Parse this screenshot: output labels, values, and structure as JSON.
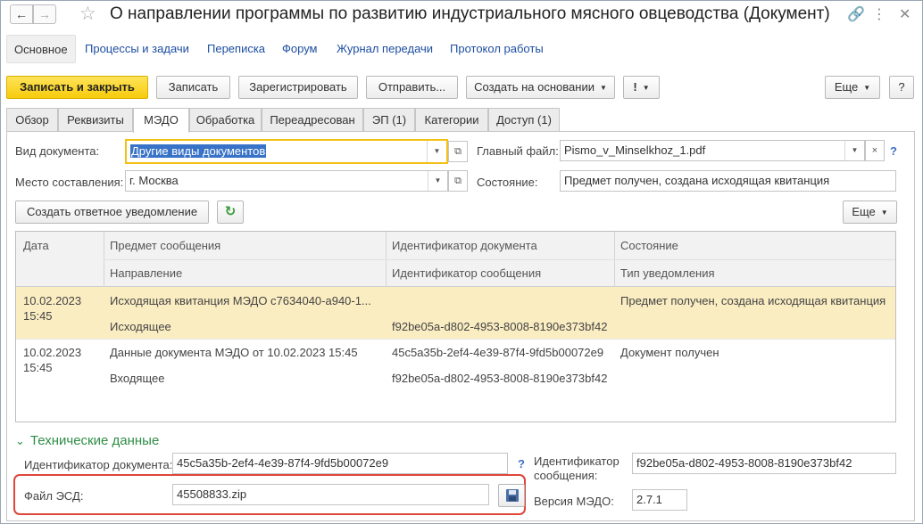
{
  "window": {
    "title": "О направлении программы по развитию индустриального мясного овцеводства (Документ)"
  },
  "sections": [
    {
      "label": "Основное"
    },
    {
      "label": "Процессы и задачи"
    },
    {
      "label": "Переписка"
    },
    {
      "label": "Форум"
    },
    {
      "label": "Журнал передачи"
    },
    {
      "label": "Протокол работы"
    }
  ],
  "toolbar": {
    "save_close": "Записать и закрыть",
    "save": "Записать",
    "register": "Зарегистрировать",
    "send": "Отправить...",
    "create_based": "Создать на основании",
    "important": "!",
    "more": "Еще",
    "help": "?"
  },
  "tabs": [
    {
      "label": "Обзор"
    },
    {
      "label": "Реквизиты"
    },
    {
      "label": "МЭДО"
    },
    {
      "label": "Обработка"
    },
    {
      "label": "Переадресован"
    },
    {
      "label": "ЭП (1)"
    },
    {
      "label": "Категории"
    },
    {
      "label": "Доступ (1)"
    }
  ],
  "form": {
    "doc_type_label": "Вид документа:",
    "doc_type_value": "Другие виды документов",
    "place_label": "Место составления:",
    "place_value": "г. Москва",
    "main_file_label": "Главный файл:",
    "main_file_value": "Pismo_v_Minselkhoz_1.pdf",
    "state_label": "Состояние:",
    "state_value": "Предмет получен, создана исходящая квитанция",
    "create_reply_button": "Создать ответное уведомление",
    "more_button": "Еще",
    "help": "?"
  },
  "table": {
    "headers": {
      "date": "Дата",
      "subject": "Предмет сообщения",
      "direction": "Направление",
      "doc_id": "Идентификатор документа",
      "msg_id": "Идентификатор сообщения",
      "state": "Состояние",
      "notice_type": "Тип уведомления"
    },
    "rows": [
      {
        "date": "10.02.2023",
        "time": "15:45",
        "subject": "Исходящая квитанция МЭДО с7634040-a940-1...",
        "direction": "Исходящее",
        "doc_id": "",
        "msg_id": "f92be05a-d802-4953-8008-8190e373bf42",
        "state": "Предмет получен, создана исходящая квитанция",
        "notice_type": ""
      },
      {
        "date": "10.02.2023",
        "time": "15:45",
        "subject": "Данные документа МЭДО от 10.02.2023 15:45",
        "direction": "Входящее",
        "doc_id": "45c5a35b-2ef4-4e39-87f4-9fd5b00072e9",
        "msg_id": "f92be05a-d802-4953-8008-8190e373bf42",
        "state": "Документ получен",
        "notice_type": ""
      }
    ]
  },
  "tech": {
    "group_title": "Технические данные",
    "doc_id_label": "Идентификатор документа:",
    "doc_id_value": "45c5a35b-2ef4-4e39-87f4-9fd5b00072e9",
    "help": "?",
    "msg_id_label_line1": "Идентификатор",
    "msg_id_label_line2": "сообщения:",
    "msg_id_value": "f92be05a-d802-4953-8008-8190e373bf42",
    "esd_file_label": "Файл ЭСД:",
    "esd_file_value": "45508833.zip",
    "medo_version_label": "Версия МЭДО:",
    "medo_version_value": "2.7.1"
  },
  "colors": {
    "primary_button": "#f7cc0b",
    "selected_row": "#fbedc2",
    "link": "#1d4ea1",
    "group_title": "#2f8d46",
    "highlight": "#e0453a",
    "focus": "#f3c016"
  }
}
